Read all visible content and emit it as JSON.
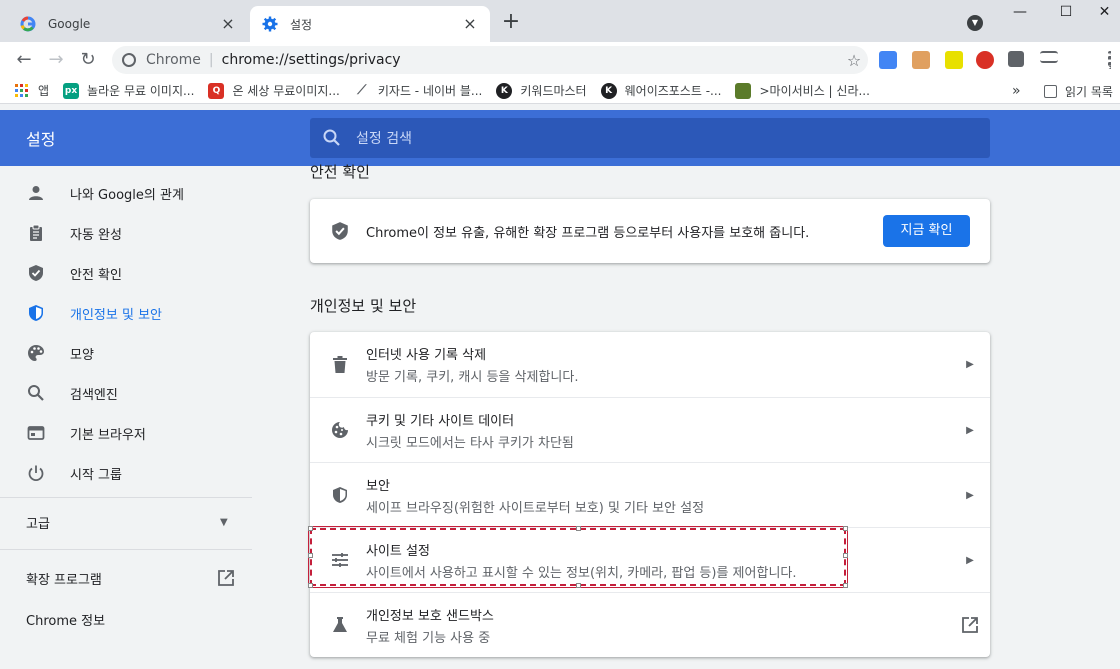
{
  "tabs": [
    {
      "label": "Google",
      "favicon": "google-g-icon",
      "active": false
    },
    {
      "label": "설정",
      "favicon": "settings-gear-icon",
      "active": true
    }
  ],
  "window": {
    "minimize": "—",
    "maximize": "☐",
    "close": "✕"
  },
  "omnibox": {
    "scheme": "Chrome",
    "url": "chrome://settings/privacy"
  },
  "bookmarks": [
    {
      "label": "앱",
      "icon": "apps-grid-icon",
      "color": "#e8710a"
    },
    {
      "label": "놀라운 무료 이미지...",
      "icon": "px-icon",
      "badge": "px",
      "color": "#05a081"
    },
    {
      "label": "온 세상 무료이미지...",
      "icon": "q-icon",
      "badge": "Q",
      "color": "#d93025"
    },
    {
      "label": "키자드 - 네이버 블...",
      "icon": "wand-icon",
      "badge": "",
      "color": "#5f6368"
    },
    {
      "label": "키워드마스터",
      "icon": "k-icon",
      "badge": "K",
      "color": "#202124"
    },
    {
      "label": "웨어이즈포스트 -...",
      "icon": "k-icon",
      "badge": "K",
      "color": "#202124"
    },
    {
      "label": ">마이서비스 | 신라...",
      "icon": "game-icon",
      "badge": "",
      "color": "#5b7b2a"
    }
  ],
  "bookmarks_more": "»",
  "reading_list": "읽기 목록",
  "header": {
    "title": "설정",
    "search_placeholder": "설정 검색"
  },
  "sidebar": {
    "items": [
      {
        "label": "나와 Google의 관계",
        "icon": "person-icon"
      },
      {
        "label": "자동 완성",
        "icon": "clipboard-icon"
      },
      {
        "label": "안전 확인",
        "icon": "shield-check-icon"
      },
      {
        "label": "개인정보 및 보안",
        "icon": "shield-half-icon",
        "selected": true
      },
      {
        "label": "모양",
        "icon": "palette-icon"
      },
      {
        "label": "검색엔진",
        "icon": "search-icon"
      },
      {
        "label": "기본 브라우저",
        "icon": "browser-icon"
      },
      {
        "label": "시작 그룹",
        "icon": "power-icon"
      }
    ],
    "advanced": "고급",
    "extensions": "확장 프로그램",
    "about": "Chrome 정보"
  },
  "safety_check": {
    "title": "안전 확인",
    "text": "Chrome이 정보 유출, 유해한 확장 프로그램 등으로부터 사용자를 보호해 줍니다.",
    "button": "지금 확인"
  },
  "privacy": {
    "title": "개인정보 및 보안",
    "rows": [
      {
        "title": "인터넷 사용 기록 삭제",
        "subtitle": "방문 기록, 쿠키, 캐시 등을 삭제합니다.",
        "icon": "trash-icon",
        "action": "arrow"
      },
      {
        "title": "쿠키 및 기타 사이트 데이터",
        "subtitle": "시크릿 모드에서는 타사 쿠키가 차단됨",
        "icon": "cookie-icon",
        "action": "arrow"
      },
      {
        "title": "보안",
        "subtitle": "세이프 브라우징(위험한 사이트로부터 보호) 및 기타 보안 설정",
        "icon": "shield-half-icon",
        "action": "arrow"
      },
      {
        "title": "사이트 설정",
        "subtitle": "사이트에서 사용하고 표시할 수 있는 정보(위치, 카메라, 팝업 등)를 제어합니다.",
        "icon": "tune-icon",
        "action": "arrow",
        "highlighted": true
      },
      {
        "title": "개인정보 보호 샌드박스",
        "subtitle": "무료 체험 기능 사용 중",
        "icon": "flask-icon",
        "action": "external"
      }
    ]
  },
  "colors": {
    "header_blue": "#3c6ed6",
    "accent": "#1a73e8",
    "highlight": "#c41f3b"
  }
}
